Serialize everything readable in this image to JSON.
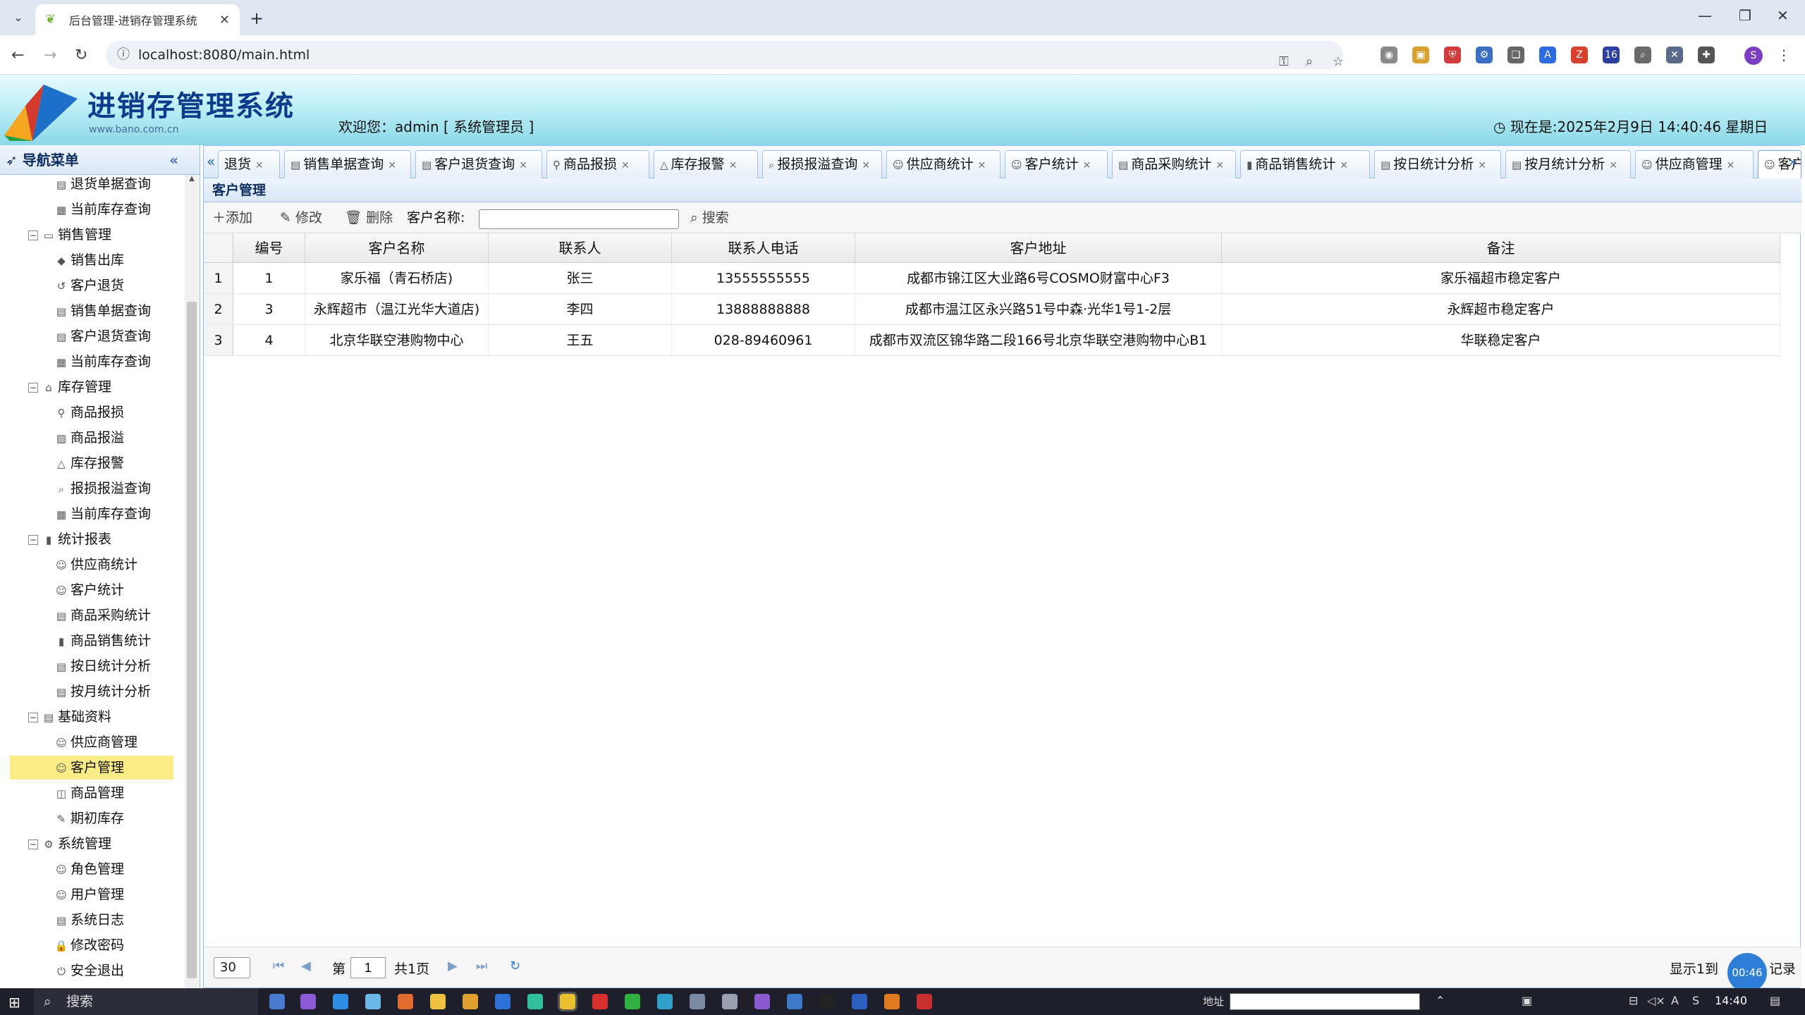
{
  "browser": {
    "tab_title": "后台管理-进销存管理系统",
    "url": "localhost:8080/main.html",
    "profile_initial": "S",
    "ext_badge": "16"
  },
  "header": {
    "app_title": "进销存管理系统",
    "app_url": "www.bano.com.cn",
    "welcome": "欢迎您：admin [ 系统管理员 ]",
    "clock": "现在是:2025年2月9日 14:40:46 星期日"
  },
  "sidebar": {
    "title": "导航菜单",
    "items": [
      {
        "label": "退货单据查询",
        "icon": "doc",
        "level": 2
      },
      {
        "label": "当前库存查询",
        "icon": "box",
        "level": 2
      },
      {
        "label": "销售管理",
        "icon": "folder",
        "level": 1
      },
      {
        "label": "销售出库",
        "icon": "tag",
        "level": 2
      },
      {
        "label": "客户退货",
        "icon": "return",
        "level": 2
      },
      {
        "label": "销售单据查询",
        "icon": "doc",
        "level": 2
      },
      {
        "label": "客户退货查询",
        "icon": "doc",
        "level": 2
      },
      {
        "label": "当前库存查询",
        "icon": "box",
        "level": 2
      },
      {
        "label": "库存管理",
        "icon": "home",
        "level": 1
      },
      {
        "label": "商品报损",
        "icon": "bike",
        "level": 2
      },
      {
        "label": "商品报溢",
        "icon": "img",
        "level": 2
      },
      {
        "label": "库存报警",
        "icon": "warn",
        "level": 2
      },
      {
        "label": "报损报溢查询",
        "icon": "search",
        "level": 2
      },
      {
        "label": "当前库存查询",
        "icon": "box",
        "level": 2
      },
      {
        "label": "统计报表",
        "icon": "chart",
        "level": 1
      },
      {
        "label": "供应商统计",
        "icon": "user",
        "level": 2
      },
      {
        "label": "客户统计",
        "icon": "users",
        "level": 2
      },
      {
        "label": "商品采购统计",
        "icon": "doc",
        "level": 2
      },
      {
        "label": "商品销售统计",
        "icon": "chart",
        "level": 2
      },
      {
        "label": "按日统计分析",
        "icon": "doc",
        "level": 2
      },
      {
        "label": "按月统计分析",
        "icon": "doc",
        "level": 2
      },
      {
        "label": "基础资料",
        "icon": "list",
        "level": 1
      },
      {
        "label": "供应商管理",
        "icon": "user",
        "level": 2
      },
      {
        "label": "客户管理",
        "icon": "user",
        "level": 2,
        "selected": true
      },
      {
        "label": "商品管理",
        "icon": "cube",
        "level": 2
      },
      {
        "label": "期初库存",
        "icon": "edit",
        "level": 2
      },
      {
        "label": "系统管理",
        "icon": "gear",
        "level": 1
      },
      {
        "label": "角色管理",
        "icon": "user",
        "level": 2
      },
      {
        "label": "用户管理",
        "icon": "user",
        "level": 2
      },
      {
        "label": "系统日志",
        "icon": "doc",
        "level": 2
      },
      {
        "label": "修改密码",
        "icon": "lock",
        "level": 2
      },
      {
        "label": "安全退出",
        "icon": "power",
        "level": 2
      }
    ]
  },
  "tabs": [
    {
      "label": "退货"
    },
    {
      "label": "销售单据查询"
    },
    {
      "label": "客户退货查询"
    },
    {
      "label": "商品报损"
    },
    {
      "label": "库存报警"
    },
    {
      "label": "报损报溢查询"
    },
    {
      "label": "供应商统计"
    },
    {
      "label": "客户统计"
    },
    {
      "label": "商品采购统计"
    },
    {
      "label": "商品销售统计"
    },
    {
      "label": "按日统计分析"
    },
    {
      "label": "按月统计分析"
    },
    {
      "label": "供应商管理"
    },
    {
      "label": "客户"
    }
  ],
  "panel": {
    "title": "客户管理",
    "toolbar": {
      "add": "添加",
      "edit": "修改",
      "delete": "删除",
      "search_label": "客户名称:",
      "search_value": "",
      "search_button": "搜索"
    },
    "columns": [
      "编号",
      "客户名称",
      "联系人",
      "联系人电话",
      "客户地址",
      "备注"
    ],
    "rows": [
      {
        "n": "1",
        "id": "1",
        "name": "家乐福（青石桥店)",
        "contact": "张三",
        "phone": "13555555555",
        "address": "成都市锦江区大业路6号COSMO财富中心F3",
        "note": "家乐福超市稳定客户"
      },
      {
        "n": "2",
        "id": "3",
        "name": "永辉超市（温江光华大道店)",
        "contact": "李四",
        "phone": "13888888888",
        "address": "成都市温江区永兴路51号中森·光华1号1-2层",
        "note": "永辉超市稳定客户"
      },
      {
        "n": "3",
        "id": "4",
        "name": "北京华联空港购物中心",
        "contact": "王五",
        "phone": "028-89460961",
        "address": "成都市双流区锦华路二段166号北京华联空港购物中心B1",
        "note": "华联稳定客户"
      }
    ]
  },
  "pager": {
    "page_size": "30",
    "page_prefix": "第",
    "page": "1",
    "page_total": "共1页",
    "info": "显示1到",
    "info_end": "记录"
  },
  "timer": "00:46",
  "taskbar": {
    "search": "搜索",
    "addr_label": "地址",
    "time": "14:40"
  }
}
